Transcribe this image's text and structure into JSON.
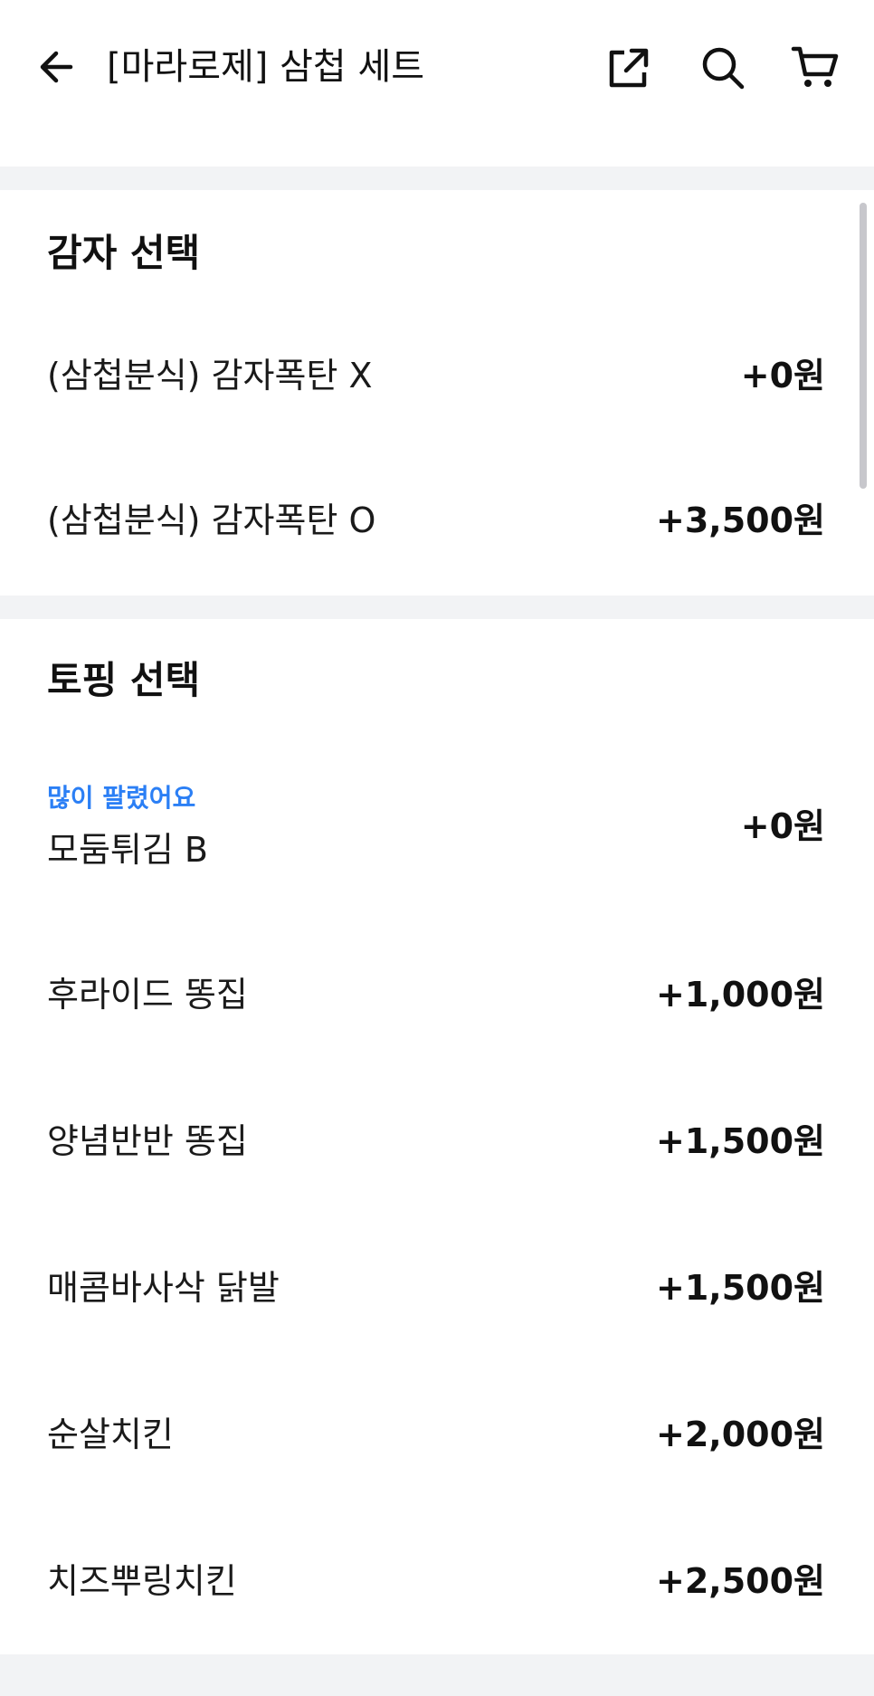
{
  "header": {
    "title": "[마라로제] 삼첩 세트",
    "icons": [
      "back-arrow-icon",
      "share-icon",
      "search-icon",
      "cart-icon"
    ]
  },
  "sections": [
    {
      "title": "감자 선택",
      "options": [
        {
          "label": "(삼첩분식) 감자폭탄 X",
          "price": "+0원"
        },
        {
          "label": "(삼첩분식) 감자폭탄 O",
          "price": "+3,500원"
        }
      ]
    },
    {
      "title": "토핑 선택",
      "options": [
        {
          "badge": "많이 팔렸어요",
          "label": "모둠튀김 B",
          "price": "+0원"
        },
        {
          "label": "후라이드 똥집",
          "price": "+1,000원"
        },
        {
          "label": "양념반반 똥집",
          "price": "+1,500원"
        },
        {
          "label": "매콤바사삭 닭발",
          "price": "+1,500원"
        },
        {
          "label": "순살치킨",
          "price": "+2,000원"
        },
        {
          "label": "치즈뿌링치킨",
          "price": "+2,500원"
        }
      ]
    }
  ],
  "colors": {
    "accent_badge": "#2b7ff5",
    "divider": "#f2f3f5",
    "text": "#111111"
  }
}
